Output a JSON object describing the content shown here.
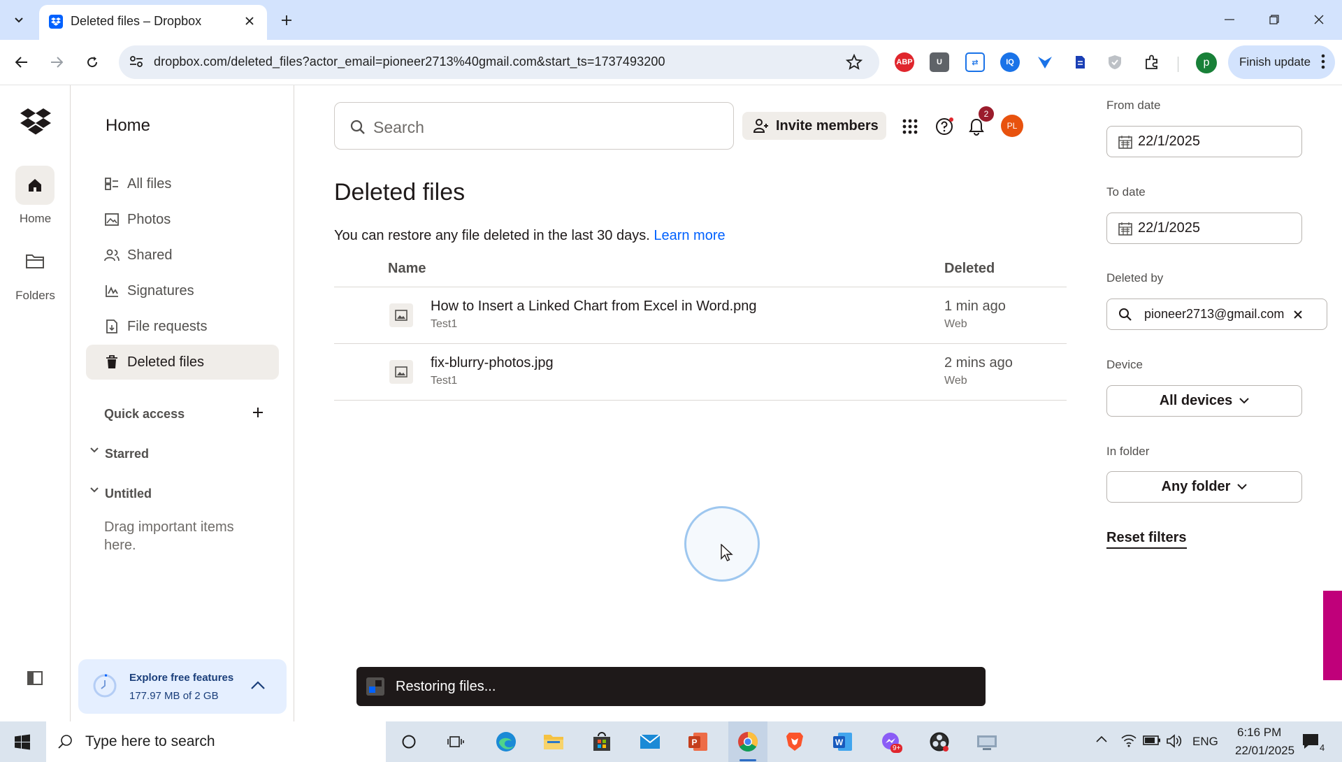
{
  "browser": {
    "tab_title": "Deleted files – Dropbox",
    "url": "dropbox.com/deleted_files?actor_email=pioneer2713%40gmail.com&start_ts=1737493200",
    "profile_initial": "p",
    "finish_update": "Finish update",
    "extensions": [
      "adblock-icon",
      "u-extension-icon",
      "sync-extension-icon",
      "iq-extension-icon",
      "arrow-extension-icon",
      "doc-extension-icon",
      "shield-extension-icon",
      "puzzle-extensions-icon"
    ]
  },
  "rail": {
    "home_label": "Home",
    "folders_label": "Folders"
  },
  "sidebar": {
    "title": "Home",
    "items": [
      {
        "label": "All files"
      },
      {
        "label": "Photos"
      },
      {
        "label": "Shared"
      },
      {
        "label": "Signatures"
      },
      {
        "label": "File requests"
      },
      {
        "label": "Deleted files"
      }
    ],
    "quick_access": "Quick access",
    "starred": "Starred",
    "untitled": "Untitled",
    "drag_hint": "Drag important items here.",
    "explore_title": "Explore free features",
    "explore_storage": "177.97 MB of 2 GB"
  },
  "header": {
    "search_placeholder": "Search",
    "invite": "Invite members",
    "notif_count": "2",
    "avatar_initials": "PL"
  },
  "main": {
    "title": "Deleted files",
    "subtitle": "You can restore any file deleted in the last 30 days.",
    "learn_more": "Learn more",
    "col_name": "Name",
    "col_deleted": "Deleted",
    "rows": [
      {
        "name": "How to Insert a Linked Chart from Excel in Word.png",
        "folder": "Test1",
        "time": "1 min ago",
        "source": "Web"
      },
      {
        "name": "fix-blurry-photos.jpg",
        "folder": "Test1",
        "time": "2 mins ago",
        "source": "Web"
      }
    ],
    "toast": "Restoring files..."
  },
  "filters": {
    "from_label": "From date",
    "from_value": "22/1/2025",
    "to_label": "To date",
    "to_value": "22/1/2025",
    "deleted_by_label": "Deleted by",
    "deleted_by_value": "pioneer2713@gmail.com",
    "device_label": "Device",
    "device_value": "All devices",
    "folder_label": "In folder",
    "folder_value": "Any folder",
    "reset": "Reset filters"
  },
  "taskbar": {
    "search_placeholder": "Type here to search",
    "lang": "ENG",
    "time": "6:16 PM",
    "date": "22/01/2025",
    "notifications": "4",
    "mail_badge": "9+"
  },
  "colors": {
    "dropbox_blue": "#0061fe",
    "chrome_tab_bar": "#d3e3fd",
    "toast_bg": "#1e1919",
    "avatar": "#e8520e"
  }
}
